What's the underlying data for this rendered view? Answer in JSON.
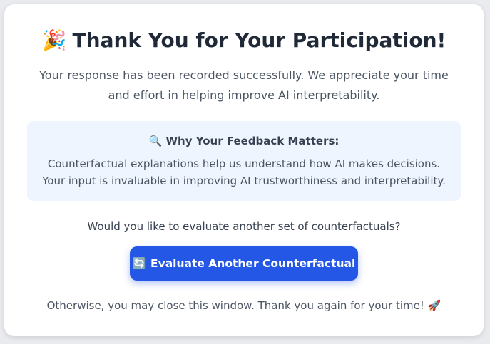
{
  "card": {
    "title_emoji": "🎉",
    "title": "Thank You for Your Participation!",
    "subtitle": "Your response has been recorded successfully. We appreciate your time and effort in helping improve AI interpretability.",
    "info": {
      "icon": "🔍",
      "heading": "Why Your Feedback Matters:",
      "body": "Counterfactual explanations help us understand how AI makes decisions. Your input is invaluable in improving AI trustworthiness and interpretability."
    },
    "question": "Would you like to evaluate another set of counterfactuals?",
    "button": {
      "icon": "🔄",
      "label": "Evaluate Another Counterfactual"
    },
    "footer": {
      "text": "Otherwise, you may close this window. Thank you again for your time!",
      "icon": "🚀"
    }
  },
  "colors": {
    "primary_button": "#2457e6",
    "info_background": "#eef5fe",
    "title_text": "#1f2937"
  }
}
